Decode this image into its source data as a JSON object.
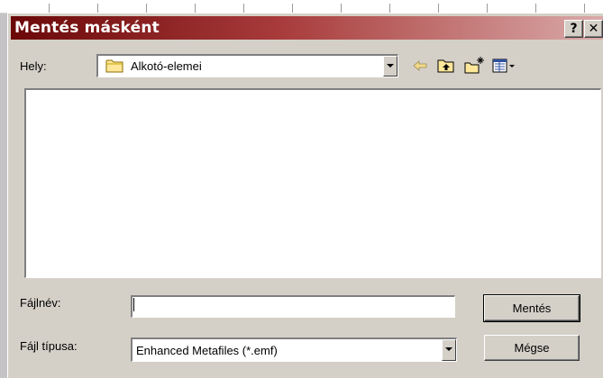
{
  "dialog": {
    "title": "Mentés másként",
    "help_button": "?",
    "close_button": "✕"
  },
  "location": {
    "label": "Hely:",
    "value": "Alkotó-elemei"
  },
  "toolbar": {
    "icons": [
      "back-arrow-icon",
      "up-folder-icon",
      "new-folder-icon",
      "view-menu-icon"
    ]
  },
  "file_name": {
    "label": "Fájlnév:",
    "value": ""
  },
  "file_type": {
    "label": "Fájl típusa:",
    "value": "Enhanced Metafiles (*.emf)"
  },
  "buttons": {
    "save": "Mentés",
    "cancel": "Mégse"
  },
  "colors": {
    "title_start": "#6b0808",
    "title_end": "#d9aaa8",
    "face": "#d4d0c8"
  }
}
